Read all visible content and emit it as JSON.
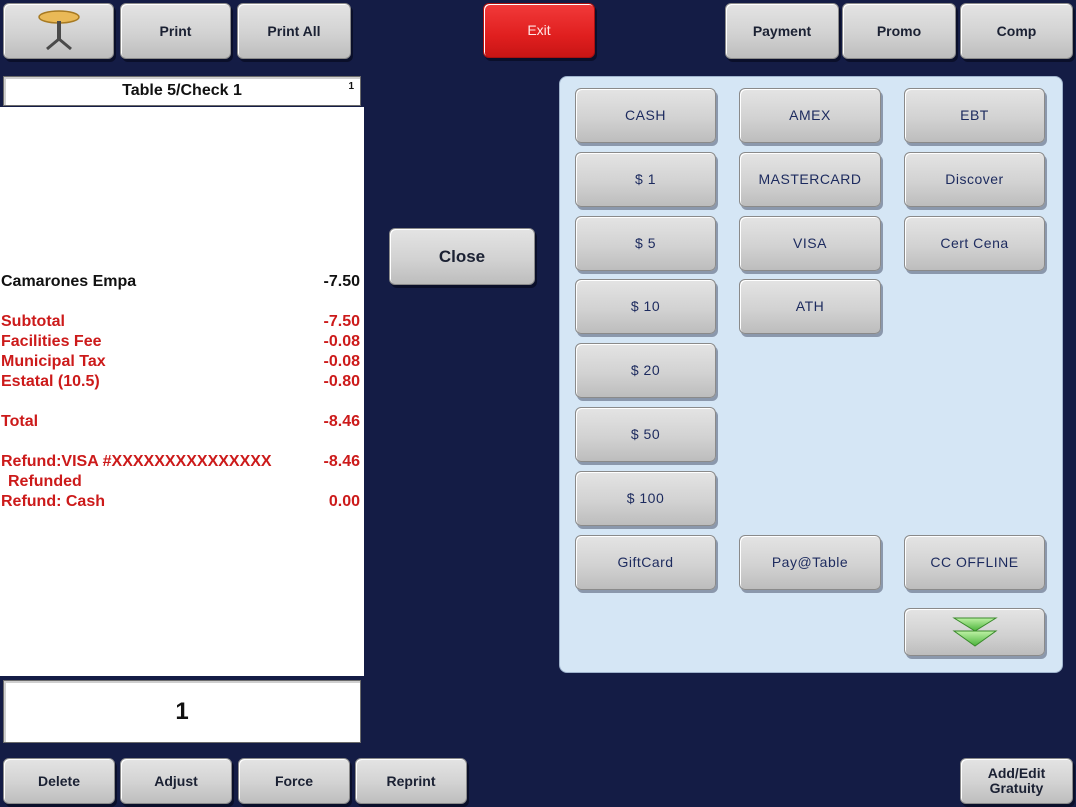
{
  "toolbar": {
    "print": "Print",
    "print_all": "Print All",
    "exit": "Exit",
    "payment": "Payment",
    "promo": "Promo",
    "comp": "Comp"
  },
  "check": {
    "header": "Table 5/Check 1",
    "seat_number": "1",
    "items": [
      {
        "label": "Camarones Empa",
        "amount": "-7.50"
      }
    ],
    "totals": [
      {
        "label": "Subtotal",
        "amount": "-7.50"
      },
      {
        "label": "Facilities Fee",
        "amount": "-0.08"
      },
      {
        "label": "Municipal Tax",
        "amount": "-0.08"
      },
      {
        "label": "Estatal (10.5)",
        "amount": "-0.80"
      }
    ],
    "total": {
      "label": "Total",
      "amount": "-8.46"
    },
    "refunds": [
      {
        "label": "Refund:VISA #XXXXXXXXXXXXXXX",
        "amount": "-8.46"
      },
      {
        "label": " Refunded",
        "amount": ""
      },
      {
        "label": "Refund: Cash",
        "amount": "0.00"
      }
    ],
    "quantity": "1"
  },
  "actions": {
    "close": "Close",
    "delete": "Delete",
    "adjust": "Adjust",
    "force": "Force",
    "reprint": "Reprint",
    "gratuity_line1": "Add/Edit",
    "gratuity_line2": "Gratuity"
  },
  "payment_methods": {
    "cash": "CASH",
    "one": "$ 1",
    "five": "$ 5",
    "ten": "$ 10",
    "twenty": "$ 20",
    "fifty": "$ 50",
    "hundred": "$ 100",
    "giftcard": "GiftCard",
    "amex": "AMEX",
    "mastercard": "MASTERCARD",
    "visa": "VISA",
    "ath": "ATH",
    "pay_at_table": "Pay@Table",
    "ebt": "EBT",
    "discover": "Discover",
    "cert_cena": "Cert Cena",
    "cc_offline": "CC OFFLINE"
  },
  "icons": {
    "table": "table-icon",
    "scroll_down": "double-chevron-down-icon"
  }
}
